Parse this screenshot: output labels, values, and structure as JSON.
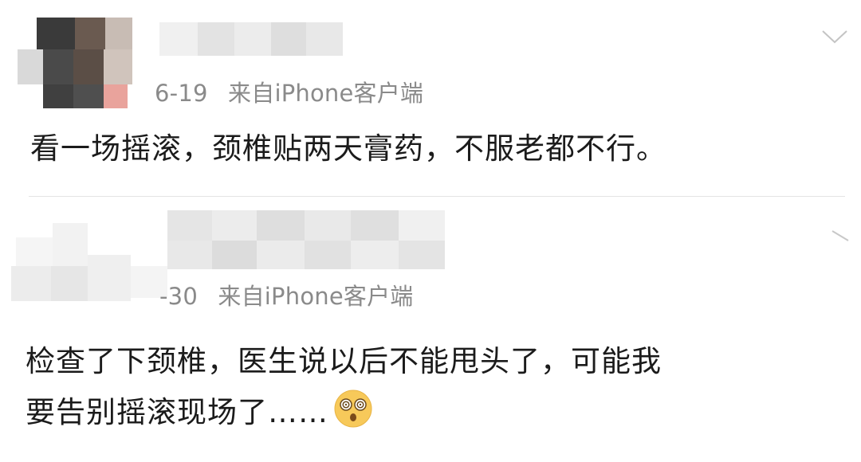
{
  "posts": [
    {
      "username": "",
      "meta": {
        "date": "6-19",
        "source": "来自iPhone客户端"
      },
      "content_lines": [
        "看一场摇滚，颈椎贴两天膏药，不服老都不行。"
      ],
      "expand_icon": "chevron-down-icon"
    },
    {
      "username": "",
      "meta": {
        "date": "-30",
        "source": "来自iPhone客户端"
      },
      "content_lines": [
        "检查了下颈椎，医生说以后不能甩头了，可能我",
        "要告别摇滚现场了……"
      ],
      "emoji": "dizzy-face-emoji",
      "expand_icon": "chevron-down-icon"
    }
  ]
}
